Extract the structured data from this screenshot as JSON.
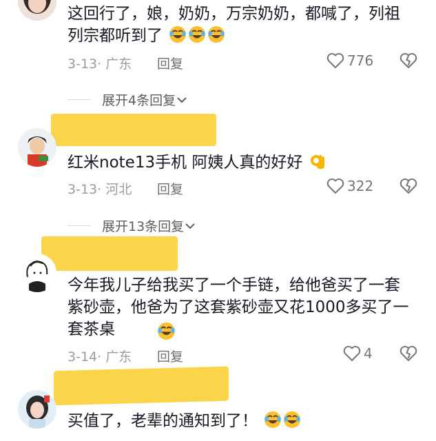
{
  "comments": [
    {
      "text": "这回行了，娘，奶奶，万宗奶奶，都喊了，列祖列宗都听到了",
      "emoji_count": 3,
      "date": "3-13",
      "location": "广东",
      "reply_label": "回复",
      "likes": "776",
      "expand_label": "展开4条回复"
    },
    {
      "text": "红米note13手机 阿姨人真的好好",
      "date": "3-13",
      "location": "河北",
      "reply_label": "回复",
      "likes": "322",
      "expand_label": "展开13条回复"
    },
    {
      "text": "今年我儿子给我买了一个手链，给他爸买了一套紫砂壶，他爸为了这套紫砂壶又花1000多买了一套茶桌",
      "date": "3-14",
      "location": "广东",
      "reply_label": "回复",
      "likes": "4"
    },
    {
      "text": "买值了，老辈的通知到了！"
    }
  ],
  "meta_separator": "·",
  "colors": {
    "highlight": "#fcd44a",
    "text": "#161823",
    "meta": "#9a9ba1"
  },
  "icons": [
    "heart-icon",
    "broken-heart-icon",
    "chevron-down-icon",
    "laughing-crying-emoji",
    "ok-hand-emoji"
  ]
}
